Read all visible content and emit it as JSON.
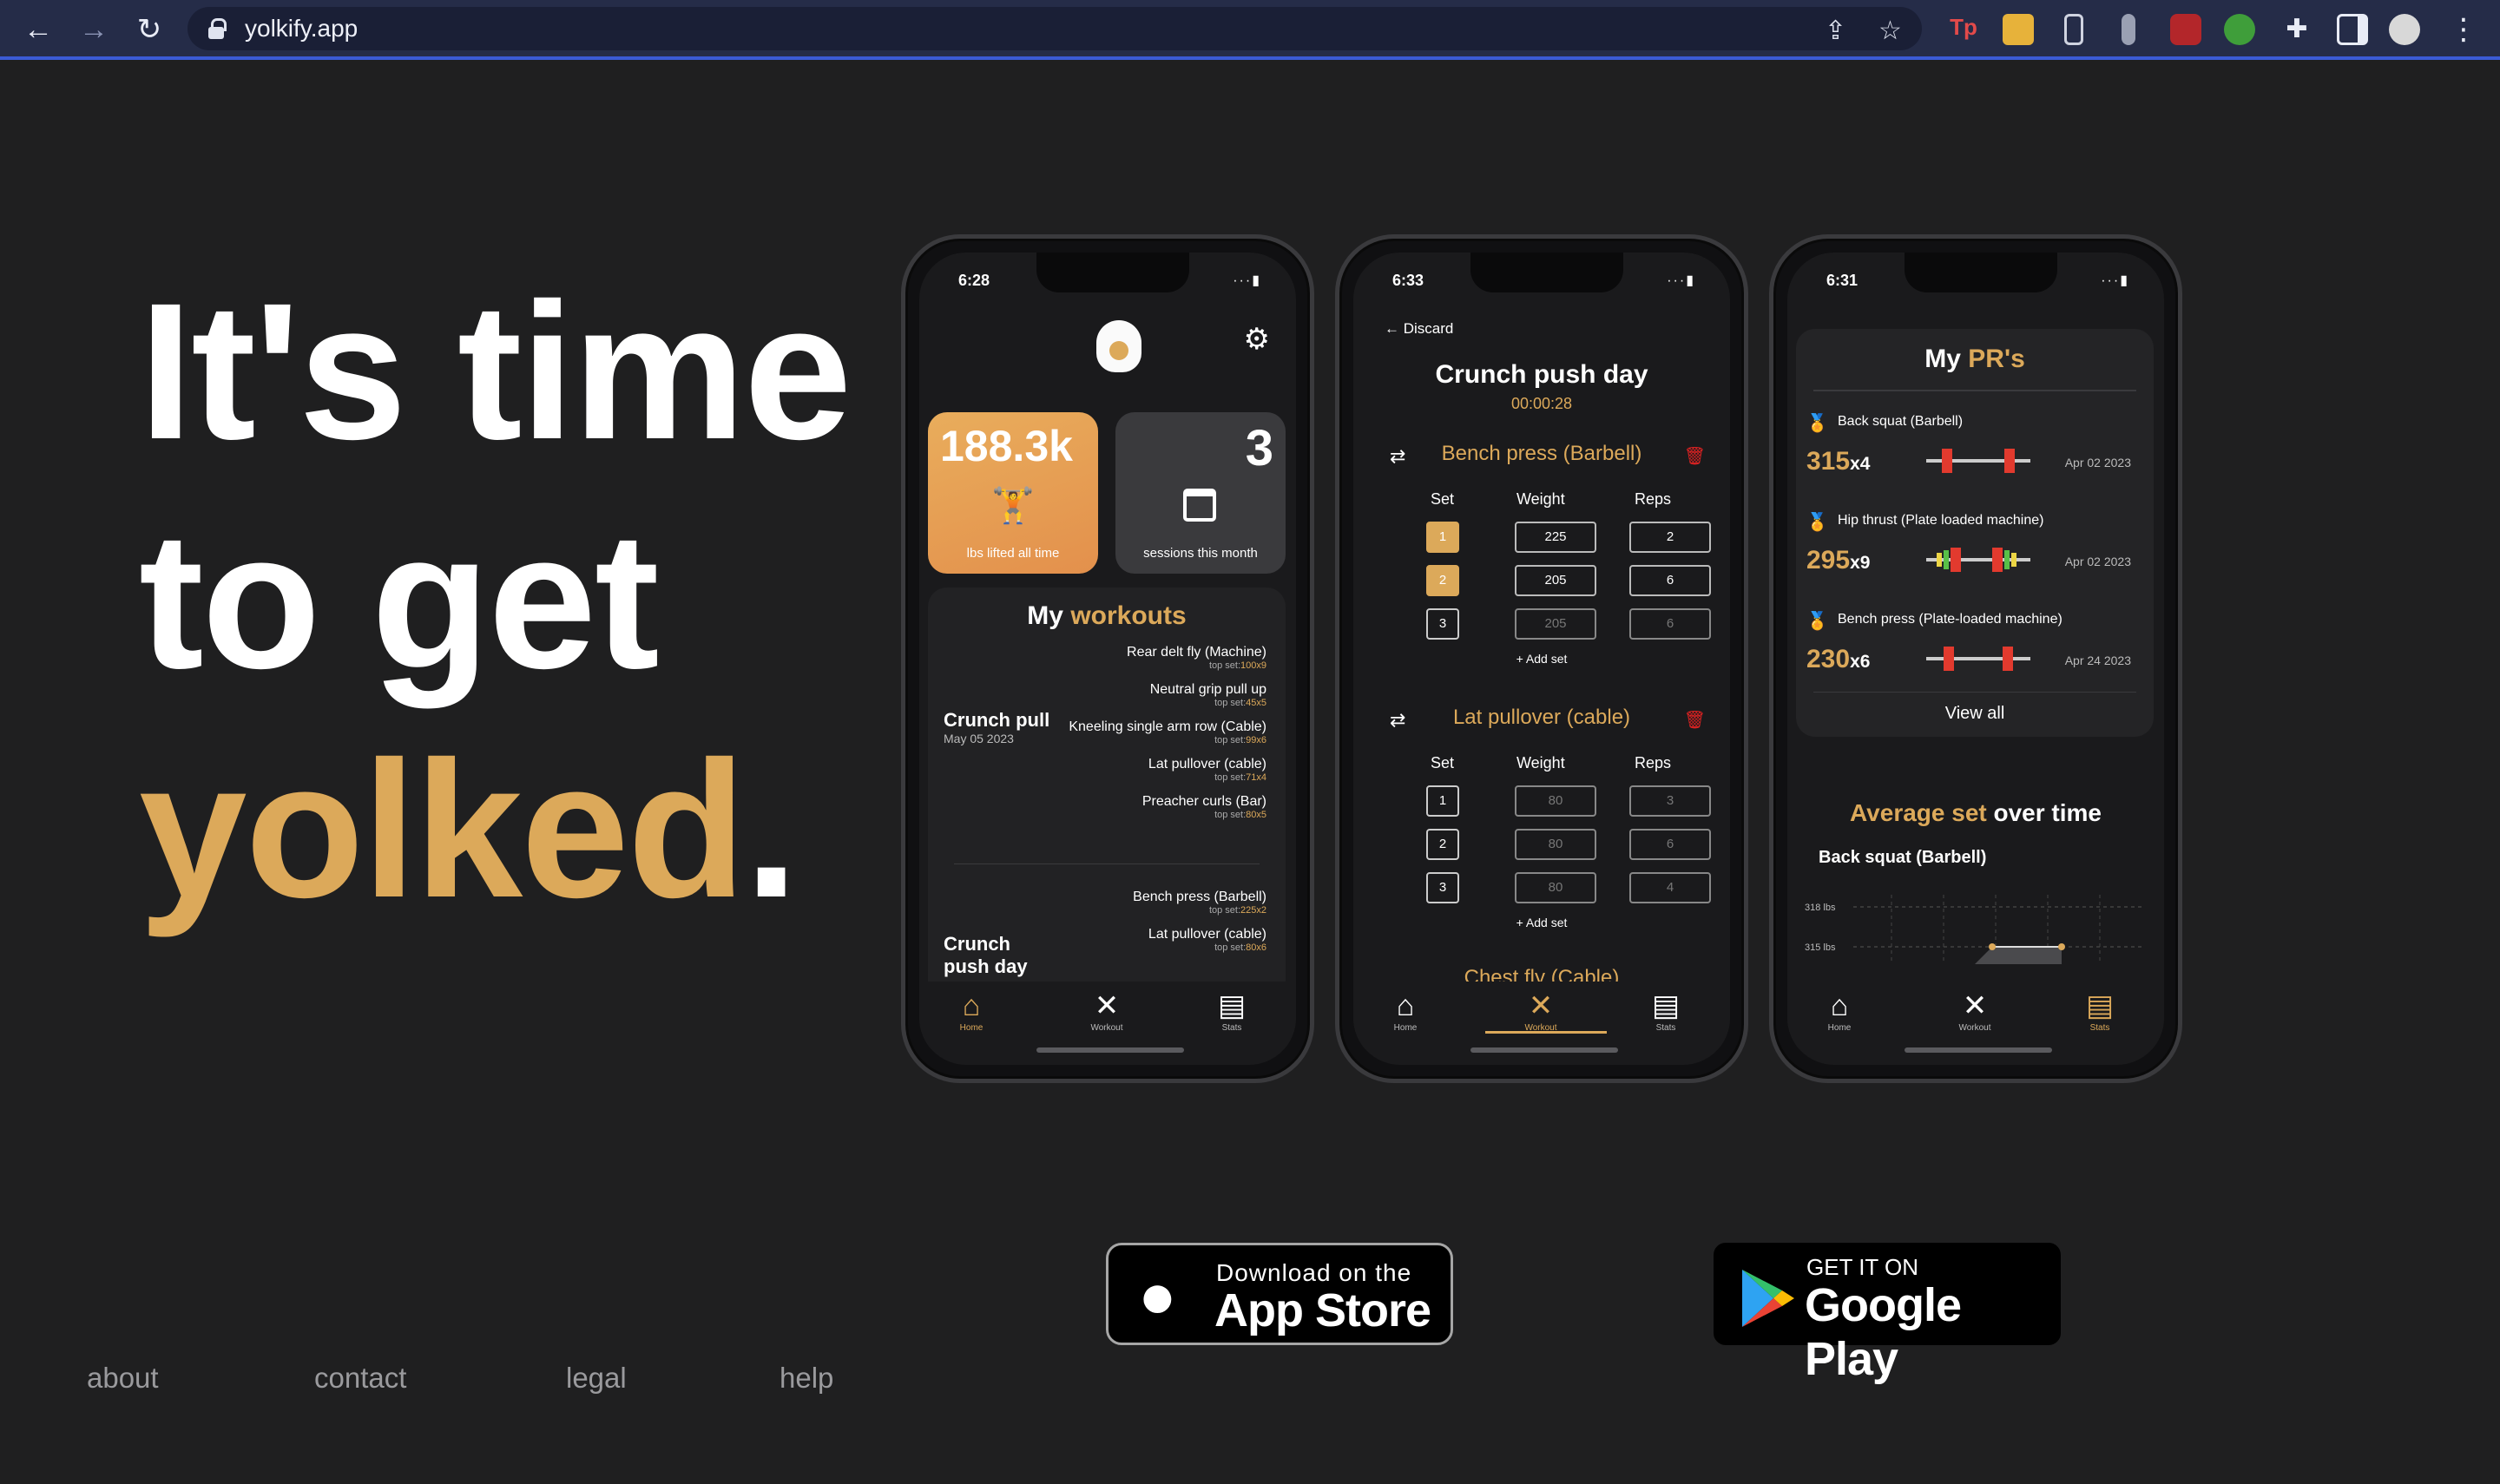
{
  "browser": {
    "url": "yolkify.app",
    "nav": {
      "back_icon": "←",
      "forward_icon": "→",
      "reload_icon": "↻"
    },
    "menu_icon": "⋮"
  },
  "hero": {
    "line1": "It's time",
    "line2": "to get",
    "line3": "yolked",
    "period": "."
  },
  "colors": {
    "accent": "#dca95a",
    "background": "#1f1f20"
  },
  "phone_home": {
    "status_time": "6:28",
    "lifted_value": "188.3k",
    "lifted_label": "lbs lifted all time",
    "sessions_value": "3",
    "sessions_label": "sessions this month",
    "workouts_title_prefix": "My",
    "workouts_title_accent": "workouts",
    "workouts": [
      {
        "name": "Crunch pull",
        "date": "May 05 2023",
        "exercises": [
          {
            "name": "Rear delt fly (Machine)",
            "top": "100x9"
          },
          {
            "name": "Neutral grip pull up",
            "top": "45x5"
          },
          {
            "name": "Kneeling single arm row (Cable)",
            "top": "99x6"
          },
          {
            "name": "Lat pullover (cable)",
            "top": "71x4"
          },
          {
            "name": "Preacher curls (Bar)",
            "top": "80x5"
          }
        ]
      },
      {
        "name": "Crunch push day",
        "date": "",
        "exercises": [
          {
            "name": "Bench press (Barbell)",
            "top": "225x2"
          },
          {
            "name": "Lat pullover (cable)",
            "top": "80x6"
          }
        ]
      }
    ],
    "top_set_label": "top set:",
    "tabs": [
      "Home",
      "Workout",
      "Stats"
    ]
  },
  "phone_workout": {
    "status_time": "6:33",
    "discard": "Discard",
    "title": "Crunch push day",
    "timer": "00:00:28",
    "col_set": "Set",
    "col_weight": "Weight",
    "col_reps": "Reps",
    "add_set": "+ Add set",
    "exercises": [
      {
        "name": "Bench press (Barbell)",
        "sets": [
          {
            "set": "1",
            "weight": "225",
            "reps": "2",
            "done": true
          },
          {
            "set": "2",
            "weight": "205",
            "reps": "6",
            "done": true
          },
          {
            "set": "3",
            "weight": "205",
            "reps": "6",
            "done": false
          }
        ]
      },
      {
        "name": "Lat pullover (cable)",
        "sets": [
          {
            "set": "1",
            "weight": "80",
            "reps": "3",
            "done": false
          },
          {
            "set": "2",
            "weight": "80",
            "reps": "6",
            "done": false
          },
          {
            "set": "3",
            "weight": "80",
            "reps": "4",
            "done": false
          }
        ]
      },
      {
        "name": "Chest fly (Cable)"
      }
    ],
    "tabs": [
      "Home",
      "Workout",
      "Stats"
    ]
  },
  "phone_stats": {
    "status_time": "6:31",
    "pr_title_prefix": "My",
    "pr_title_accent": "PR's",
    "prs": [
      {
        "name": "Back squat (Barbell)",
        "weight": "315",
        "reps": "x4",
        "date": "Apr 02 2023"
      },
      {
        "name": "Hip thrust (Plate loaded machine)",
        "weight": "295",
        "reps": "x9",
        "date": "Apr 02 2023"
      },
      {
        "name": "Bench press (Plate-loaded machine)",
        "weight": "230",
        "reps": "x6",
        "date": "Apr 24 2023"
      }
    ],
    "view_all": "View all",
    "avg_title_accent": "Average set",
    "avg_title_rest": "over time",
    "avg_exercise": "Back squat (Barbell)",
    "tabs": [
      "Home",
      "Workout",
      "Stats"
    ]
  },
  "chart_data": {
    "type": "line",
    "title": "Back squat (Barbell)",
    "ytick_labels": [
      "318 lbs",
      "315 lbs"
    ],
    "series": [
      {
        "values": [
          315,
          315
        ]
      }
    ],
    "grid": true
  },
  "stores": {
    "apple_small": "Download on the",
    "apple_big": "App Store",
    "google_small": "GET IT ON",
    "google_big": "Google Play"
  },
  "footer": [
    "about",
    "contact",
    "legal",
    "help"
  ]
}
